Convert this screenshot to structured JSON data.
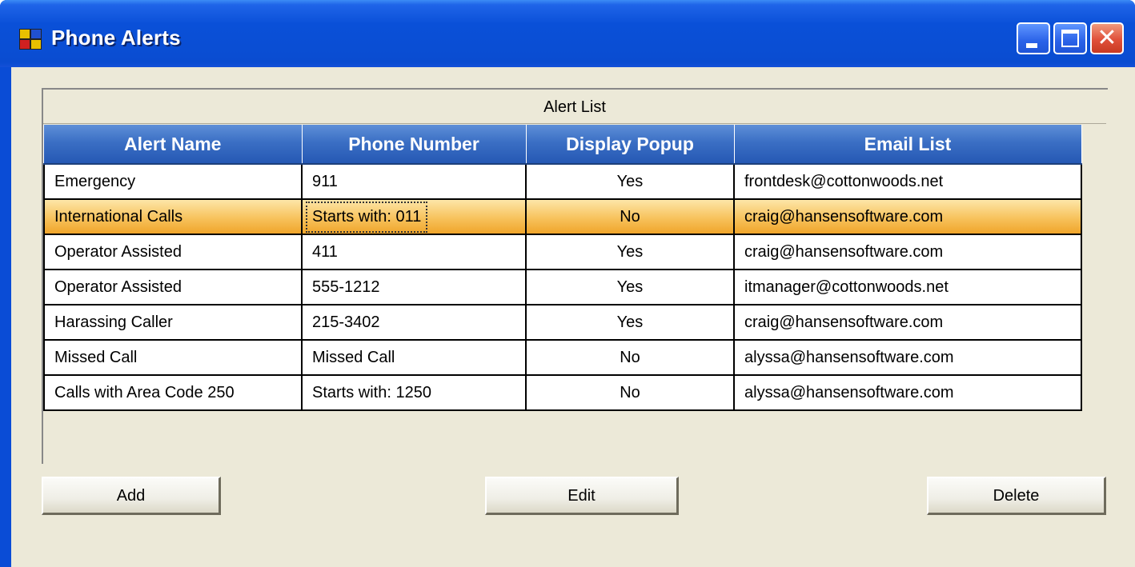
{
  "window": {
    "title": "Phone Alerts",
    "close_glyph": "✕"
  },
  "grid": {
    "caption": "Alert List",
    "columns": [
      "Alert Name",
      "Phone Number",
      "Display Popup",
      "Email List"
    ],
    "rows": [
      {
        "name": "Emergency",
        "phone": "911",
        "popup": "Yes",
        "email": "frontdesk@cottonwoods.net"
      },
      {
        "name": "International Calls",
        "phone": "Starts with: 011",
        "popup": "No",
        "email": "craig@hansensoftware.com"
      },
      {
        "name": "Operator Assisted",
        "phone": "411",
        "popup": "Yes",
        "email": "craig@hansensoftware.com"
      },
      {
        "name": "Operator Assisted",
        "phone": "555-1212",
        "popup": "Yes",
        "email": "itmanager@cottonwoods.net"
      },
      {
        "name": "Harassing Caller",
        "phone": "215-3402",
        "popup": "Yes",
        "email": "craig@hansensoftware.com"
      },
      {
        "name": "Missed Call",
        "phone": "Missed Call",
        "popup": "No",
        "email": "alyssa@hansensoftware.com"
      },
      {
        "name": "Calls with Area Code 250",
        "phone": "Starts with:  1250",
        "popup": "No",
        "email": "alyssa@hansensoftware.com"
      }
    ],
    "selected_row": 1
  },
  "buttons": {
    "add": "Add",
    "edit": "Edit",
    "delete": "Delete"
  },
  "colors": {
    "titlebar": "#0a4cd6",
    "header": "#3b6fc4",
    "selection": "#f7c25c",
    "client": "#ece9d8"
  }
}
